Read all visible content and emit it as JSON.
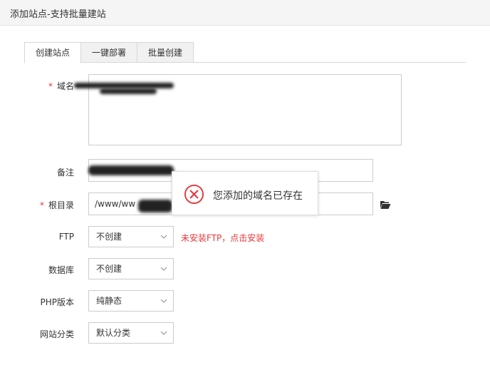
{
  "window": {
    "title": "添加站点-支持批量建站"
  },
  "tabs": [
    {
      "label": "创建站点",
      "active": true
    },
    {
      "label": "一键部署",
      "active": false
    },
    {
      "label": "批量创建",
      "active": false
    }
  ],
  "form": {
    "domain": {
      "label": "域名",
      "required_mark": "*",
      "value": ""
    },
    "remark": {
      "label": "备注",
      "value": ""
    },
    "root": {
      "label": "根目录",
      "required_mark": "*",
      "value": "/www/ww"
    },
    "ftp": {
      "label": "FTP",
      "value": "不创建",
      "warning": "未安装FTP，点击安装"
    },
    "database": {
      "label": "数据库",
      "value": "不创建"
    },
    "php": {
      "label": "PHP版本",
      "value": "纯静态"
    },
    "category": {
      "label": "网站分类",
      "value": "默认分类"
    }
  },
  "toast": {
    "message": "您添加的域名已存在",
    "icon": "error-circle-icon"
  },
  "colors": {
    "error": "#e4393c",
    "icon_red": "#e4393c"
  }
}
